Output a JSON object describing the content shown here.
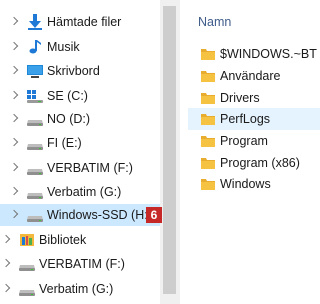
{
  "nav": {
    "items": [
      {
        "label": "Hämtade filer",
        "icon": "download-icon",
        "chevron": "right",
        "indent": 1,
        "selected": false
      },
      {
        "label": "Musik",
        "icon": "music-icon",
        "chevron": "right",
        "indent": 1,
        "selected": false
      },
      {
        "label": "Skrivbord",
        "icon": "desktop-icon",
        "chevron": "right",
        "indent": 1,
        "selected": false
      },
      {
        "label": "SE (C:)",
        "icon": "windows-drive-icon",
        "chevron": "right",
        "indent": 1,
        "selected": false
      },
      {
        "label": "NO (D:)",
        "icon": "drive-icon",
        "chevron": "right",
        "indent": 1,
        "selected": false
      },
      {
        "label": "FI (E:)",
        "icon": "drive-icon",
        "chevron": "right",
        "indent": 1,
        "selected": false
      },
      {
        "label": "VERBATIM (F:)",
        "icon": "drive-icon",
        "chevron": "right",
        "indent": 1,
        "selected": false
      },
      {
        "label": "Verbatim (G:)",
        "icon": "drive-icon",
        "chevron": "right",
        "indent": 1,
        "selected": false
      },
      {
        "label": "Windows-SSD (H:)",
        "icon": "drive-icon",
        "chevron": "right",
        "indent": 1,
        "selected": true
      },
      {
        "label": "Bibliotek",
        "icon": "library-icon",
        "chevron": "right",
        "indent": 0,
        "selected": false
      },
      {
        "label": "VERBATIM (F:)",
        "icon": "drive-icon",
        "chevron": "right",
        "indent": 0,
        "selected": false
      },
      {
        "label": "Verbatim (G:)",
        "icon": "drive-icon",
        "chevron": "right",
        "indent": 0,
        "selected": false
      }
    ],
    "badge": "6"
  },
  "content": {
    "column_header": "Namn",
    "folders": [
      {
        "name": "$WINDOWS.~BT",
        "highlighted": false
      },
      {
        "name": "Användare",
        "highlighted": false
      },
      {
        "name": "Drivers",
        "highlighted": false
      },
      {
        "name": "PerfLogs",
        "highlighted": true
      },
      {
        "name": "Program",
        "highlighted": false
      },
      {
        "name": "Program (x86)",
        "highlighted": false
      },
      {
        "name": "Windows",
        "highlighted": false
      }
    ]
  },
  "colors": {
    "selection": "#cce8ff",
    "hover": "#e5f3ff",
    "folder": "#f5c242",
    "badge": "#c62828",
    "header": "#3f5c8a"
  }
}
